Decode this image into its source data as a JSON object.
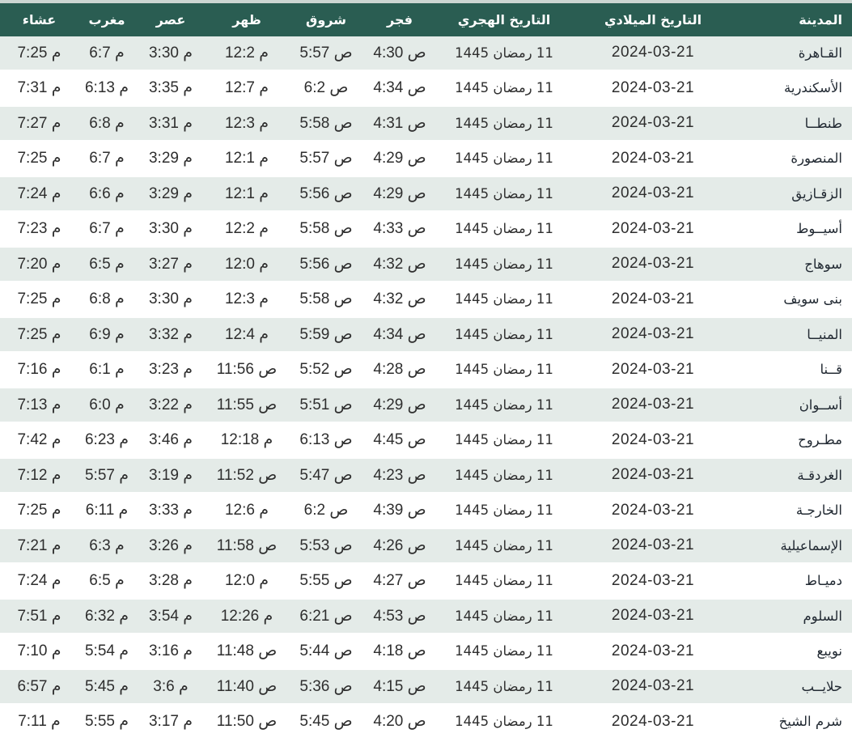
{
  "colors": {
    "header_bg": "#2a5d52",
    "header_text": "#ffffff",
    "row_shaded_bg": "#e4ebe8",
    "row_white_bg": "#ffffff",
    "top_border": "#ccd6d2",
    "cell_text": "#2e2e2e"
  },
  "table": {
    "columns": [
      {
        "key": "city",
        "label": "المدينة"
      },
      {
        "key": "miladi",
        "label": "التاريخ الميلادي"
      },
      {
        "key": "hijri",
        "label": "التاريخ الهجري"
      },
      {
        "key": "fajr",
        "label": "فجر"
      },
      {
        "key": "shorouk",
        "label": "شروق"
      },
      {
        "key": "dhuhr",
        "label": "ظهر"
      },
      {
        "key": "asr",
        "label": "عصر"
      },
      {
        "key": "maghrib",
        "label": "مغرب"
      },
      {
        "key": "isha",
        "label": "عشاء"
      }
    ],
    "time_columns": [
      "fajr",
      "shorouk",
      "dhuhr",
      "asr",
      "maghrib",
      "isha"
    ],
    "rows": [
      {
        "city": "القـاهرة",
        "miladi": "2024-03-21",
        "hijri": "11 رمضان 1445",
        "fajr": "4:30 ص",
        "shorouk": "5:57 ص",
        "dhuhr": "12:2 م",
        "asr": "3:30 م",
        "maghrib": "6:7 م",
        "isha": "7:25 م"
      },
      {
        "city": "الأسكندرية",
        "miladi": "2024-03-21",
        "hijri": "11 رمضان 1445",
        "fajr": "4:34 ص",
        "shorouk": "6:2 ص",
        "dhuhr": "12:7 م",
        "asr": "3:35 م",
        "maghrib": "6:13 م",
        "isha": "7:31 م"
      },
      {
        "city": "طنطــا",
        "miladi": "2024-03-21",
        "hijri": "11 رمضان 1445",
        "fajr": "4:31 ص",
        "shorouk": "5:58 ص",
        "dhuhr": "12:3 م",
        "asr": "3:31 م",
        "maghrib": "6:8 م",
        "isha": "7:27 م"
      },
      {
        "city": "المنصورة",
        "miladi": "2024-03-21",
        "hijri": "11 رمضان 1445",
        "fajr": "4:29 ص",
        "shorouk": "5:57 ص",
        "dhuhr": "12:1 م",
        "asr": "3:29 م",
        "maghrib": "6:7 م",
        "isha": "7:25 م"
      },
      {
        "city": "الزقـازيق",
        "miladi": "2024-03-21",
        "hijri": "11 رمضان 1445",
        "fajr": "4:29 ص",
        "shorouk": "5:56 ص",
        "dhuhr": "12:1 م",
        "asr": "3:29 م",
        "maghrib": "6:6 م",
        "isha": "7:24 م"
      },
      {
        "city": "أسيــوط",
        "miladi": "2024-03-21",
        "hijri": "11 رمضان 1445",
        "fajr": "4:33 ص",
        "shorouk": "5:58 ص",
        "dhuhr": "12:2 م",
        "asr": "3:30 م",
        "maghrib": "6:7 م",
        "isha": "7:23 م"
      },
      {
        "city": "سوهاج",
        "miladi": "2024-03-21",
        "hijri": "11 رمضان 1445",
        "fajr": "4:32 ص",
        "shorouk": "5:56 ص",
        "dhuhr": "12:0 م",
        "asr": "3:27 م",
        "maghrib": "6:5 م",
        "isha": "7:20 م"
      },
      {
        "city": "بنى سويف",
        "miladi": "2024-03-21",
        "hijri": "11 رمضان 1445",
        "fajr": "4:32 ص",
        "shorouk": "5:58 ص",
        "dhuhr": "12:3 م",
        "asr": "3:30 م",
        "maghrib": "6:8 م",
        "isha": "7:25 م"
      },
      {
        "city": "المنيــا",
        "miladi": "2024-03-21",
        "hijri": "11 رمضان 1445",
        "fajr": "4:34 ص",
        "shorouk": "5:59 ص",
        "dhuhr": "12:4 م",
        "asr": "3:32 م",
        "maghrib": "6:9 م",
        "isha": "7:25 م"
      },
      {
        "city": "قــنا",
        "miladi": "2024-03-21",
        "hijri": "11 رمضان 1445",
        "fajr": "4:28 ص",
        "shorouk": "5:52 ص",
        "dhuhr": "11:56 ص",
        "asr": "3:23 م",
        "maghrib": "6:1 م",
        "isha": "7:16 م"
      },
      {
        "city": "أســوان",
        "miladi": "2024-03-21",
        "hijri": "11 رمضان 1445",
        "fajr": "4:29 ص",
        "shorouk": "5:51 ص",
        "dhuhr": "11:55 ص",
        "asr": "3:22 م",
        "maghrib": "6:0 م",
        "isha": "7:13 م"
      },
      {
        "city": "مطـروح",
        "miladi": "2024-03-21",
        "hijri": "11 رمضان 1445",
        "fajr": "4:45 ص",
        "shorouk": "6:13 ص",
        "dhuhr": "12:18 م",
        "asr": "3:46 م",
        "maghrib": "6:23 م",
        "isha": "7:42 م"
      },
      {
        "city": "الغردقـة",
        "miladi": "2024-03-21",
        "hijri": "11 رمضان 1445",
        "fajr": "4:23 ص",
        "shorouk": "5:47 ص",
        "dhuhr": "11:52 ص",
        "asr": "3:19 م",
        "maghrib": "5:57 م",
        "isha": "7:12 م"
      },
      {
        "city": "الخارجـة",
        "miladi": "2024-03-21",
        "hijri": "11 رمضان 1445",
        "fajr": "4:39 ص",
        "shorouk": "6:2 ص",
        "dhuhr": "12:6 م",
        "asr": "3:33 م",
        "maghrib": "6:11 م",
        "isha": "7:25 م"
      },
      {
        "city": "الإسماعيلية",
        "miladi": "2024-03-21",
        "hijri": "11 رمضان 1445",
        "fajr": "4:26 ص",
        "shorouk": "5:53 ص",
        "dhuhr": "11:58 ص",
        "asr": "3:26 م",
        "maghrib": "6:3 م",
        "isha": "7:21 م"
      },
      {
        "city": "دميـاط",
        "miladi": "2024-03-21",
        "hijri": "11 رمضان 1445",
        "fajr": "4:27 ص",
        "shorouk": "5:55 ص",
        "dhuhr": "12:0 م",
        "asr": "3:28 م",
        "maghrib": "6:5 م",
        "isha": "7:24 م"
      },
      {
        "city": "السلوم",
        "miladi": "2024-03-21",
        "hijri": "11 رمضان 1445",
        "fajr": "4:53 ص",
        "shorouk": "6:21 ص",
        "dhuhr": "12:26 م",
        "asr": "3:54 م",
        "maghrib": "6:32 م",
        "isha": "7:51 م"
      },
      {
        "city": "نويبع",
        "miladi": "2024-03-21",
        "hijri": "11 رمضان 1445",
        "fajr": "4:18 ص",
        "shorouk": "5:44 ص",
        "dhuhr": "11:48 ص",
        "asr": "3:16 م",
        "maghrib": "5:54 م",
        "isha": "7:10 م"
      },
      {
        "city": "حلايــب",
        "miladi": "2024-03-21",
        "hijri": "11 رمضان 1445",
        "fajr": "4:15 ص",
        "shorouk": "5:36 ص",
        "dhuhr": "11:40 ص",
        "asr": "3:6 م",
        "maghrib": "5:45 م",
        "isha": "6:57 م"
      },
      {
        "city": "شرم الشيخ",
        "miladi": "2024-03-21",
        "hijri": "11 رمضان 1445",
        "fajr": "4:20 ص",
        "shorouk": "5:45 ص",
        "dhuhr": "11:50 ص",
        "asr": "3:17 م",
        "maghrib": "5:55 م",
        "isha": "7:11 م"
      }
    ]
  }
}
